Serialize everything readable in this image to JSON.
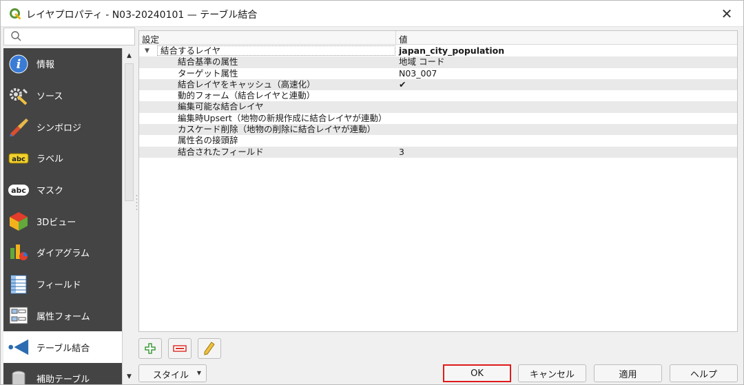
{
  "window": {
    "title": "レイヤプロパティ - N03-20240101 — テーブル結合"
  },
  "sidebar": {
    "search_placeholder": "",
    "items": [
      {
        "label": "情報",
        "icon": "info-icon"
      },
      {
        "label": "ソース",
        "icon": "source-icon"
      },
      {
        "label": "シンボロジ",
        "icon": "symbology-icon"
      },
      {
        "label": "ラベル",
        "icon": "labels-icon"
      },
      {
        "label": "マスク",
        "icon": "mask-icon"
      },
      {
        "label": "3Dビュー",
        "icon": "3d-view-icon"
      },
      {
        "label": "ダイアグラム",
        "icon": "diagram-icon"
      },
      {
        "label": "フィールド",
        "icon": "fields-icon"
      },
      {
        "label": "属性フォーム",
        "icon": "attribute-form-icon"
      },
      {
        "label": "テーブル結合",
        "icon": "joins-icon",
        "selected": true
      },
      {
        "label": "補助テーブル",
        "icon": "auxiliary-storage-icon"
      }
    ]
  },
  "table": {
    "header_setting": "設定",
    "header_value": "値",
    "group_label": "結合するレイヤ",
    "group_value": "japan_city_population",
    "rows": [
      {
        "setting": "結合基準の属性",
        "value": "地域 コード"
      },
      {
        "setting": "ターゲット属性",
        "value": "N03_007"
      },
      {
        "setting": "結合レイヤをキャッシュ（高速化）",
        "value": "✔"
      },
      {
        "setting": "動的フォーム（結合レイヤと連動）",
        "value": ""
      },
      {
        "setting": "編集可能な結合レイヤ",
        "value": ""
      },
      {
        "setting": "編集時Upsert（地物の新規作成に結合レイヤが連動）",
        "value": ""
      },
      {
        "setting": "カスケード削除（地物の削除に結合レイヤが連動）",
        "value": ""
      },
      {
        "setting": "属性名の接頭辞",
        "value": ""
      },
      {
        "setting": "結合されたフィールド",
        "value": "3"
      }
    ]
  },
  "buttons": {
    "style": "スタイル",
    "ok": "OK",
    "cancel": "キャンセル",
    "apply": "適用",
    "help": "ヘルプ"
  },
  "colors": {
    "sidebar_bg": "#444444",
    "ok_highlight": "#e01a1a",
    "qgis_green": "#589632"
  }
}
